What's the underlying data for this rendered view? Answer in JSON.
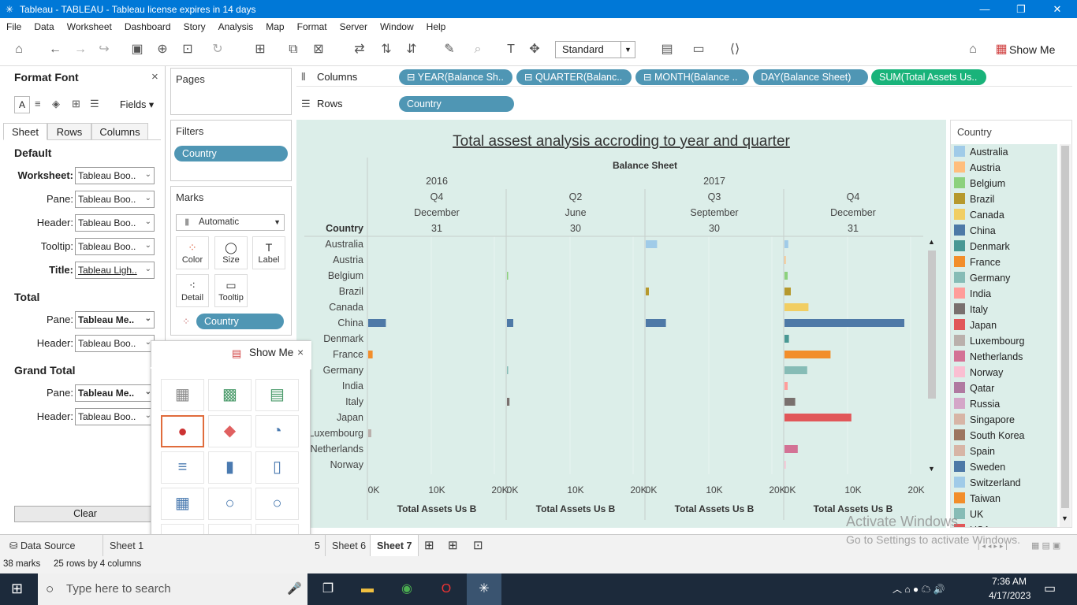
{
  "window": {
    "title": "Tableau - TABLEAU - Tableau license expires in 14 days"
  },
  "menu": [
    "File",
    "Data",
    "Worksheet",
    "Dashboard",
    "Story",
    "Analysis",
    "Map",
    "Format",
    "Server",
    "Window",
    "Help"
  ],
  "toolbar": {
    "fit_select": "Standard",
    "show_me_label": "Show Me"
  },
  "format_pane": {
    "title": "Format Font",
    "fields_label": "Fields",
    "tabs": [
      "Sheet",
      "Rows",
      "Columns"
    ],
    "default_title": "Default",
    "worksheet_label": "Worksheet:",
    "worksheet_value": "Tableau Boo..",
    "pane_label": "Pane:",
    "pane_value": "Tableau Boo..",
    "header_label": "Header:",
    "header_value": "Tableau Boo..",
    "tooltip_label": "Tooltip:",
    "tooltip_value": "Tableau Boo..",
    "title_label": "Title:",
    "title_value": "Tableau Ligh..",
    "total_title": "Total",
    "total_pane_label": "Pane:",
    "total_pane_value": "Tableau Me..",
    "total_header_label": "Header:",
    "total_header_value": "Tableau Boo..",
    "grand_total_title": "Grand Total",
    "grand_pane_label": "Pane:",
    "grand_pane_value": "Tableau Me..",
    "grand_header_label": "Header:",
    "grand_header_value": "Tableau Boo..",
    "clear_label": "Clear"
  },
  "pages_card": {
    "title": "Pages"
  },
  "filters_card": {
    "title": "Filters",
    "pill": "Country"
  },
  "marks_card": {
    "title": "Marks",
    "mark_type": "Automatic",
    "buttons": [
      "Color",
      "Size",
      "Label",
      "Detail",
      "Tooltip"
    ],
    "color_pill": "Country"
  },
  "shelves": {
    "columns_label": "Columns",
    "rows_label": "Rows",
    "column_pills": [
      "YEAR(Balance Sh..",
      "QUARTER(Balanc..",
      "MONTH(Balance ..",
      "DAY(Balance Sheet)",
      "SUM(Total Assets Us.."
    ],
    "row_pills": [
      "Country"
    ]
  },
  "show_me": {
    "title": "Show Me"
  },
  "bottom_tabs": {
    "data_source": "Data Source",
    "tabs": [
      "Sheet 1",
      "5",
      "Sheet 6",
      "Sheet 7"
    ]
  },
  "status": {
    "marks": "38 marks",
    "dims": "25 rows by 4 columns"
  },
  "taskbar": {
    "search_placeholder": "Type here to search",
    "time": "7:36 AM",
    "date": "4/17/2023"
  },
  "watermark": {
    "line1": "Activate Windows",
    "line2": "Go to Settings to activate Windows."
  },
  "legend": {
    "title": "Country",
    "items": [
      {
        "name": "Australia",
        "color": "#a0cbe8"
      },
      {
        "name": "Austria",
        "color": "#ffbe7d"
      },
      {
        "name": "Belgium",
        "color": "#8cd17d"
      },
      {
        "name": "Brazil",
        "color": "#b6992d"
      },
      {
        "name": "Canada",
        "color": "#f1ce63"
      },
      {
        "name": "China",
        "color": "#4e79a7"
      },
      {
        "name": "Denmark",
        "color": "#499894"
      },
      {
        "name": "France",
        "color": "#f28e2b"
      },
      {
        "name": "Germany",
        "color": "#86bcb6"
      },
      {
        "name": "India",
        "color": "#ff9d9a"
      },
      {
        "name": "Italy",
        "color": "#79706e"
      },
      {
        "name": "Japan",
        "color": "#e15759"
      },
      {
        "name": "Luxembourg",
        "color": "#bab0ac"
      },
      {
        "name": "Netherlands",
        "color": "#d37295"
      },
      {
        "name": "Norway",
        "color": "#fabfd2"
      },
      {
        "name": "Qatar",
        "color": "#b07aa1"
      },
      {
        "name": "Russia",
        "color": "#d4a6c8"
      },
      {
        "name": "Singapore",
        "color": "#d7b5a6"
      },
      {
        "name": "South Korea",
        "color": "#9d7660"
      },
      {
        "name": "Spain",
        "color": "#d7b5a6"
      },
      {
        "name": "Sweden",
        "color": "#4e79a7"
      },
      {
        "name": "Switzerland",
        "color": "#a0cbe8"
      },
      {
        "name": "Taiwan",
        "color": "#f28e2b"
      },
      {
        "name": "UK",
        "color": "#86bcb6"
      },
      {
        "name": "USA",
        "color": "#e15759"
      }
    ]
  },
  "chart_data": {
    "type": "bar",
    "title": "Total assest analysis accroding to year and quarter",
    "header_field": "Balance Sheet",
    "row_header": "Country",
    "panes": [
      {
        "year": "2016",
        "quarter": "Q4",
        "month": "December",
        "day": "31"
      },
      {
        "year": "2017",
        "quarter": "Q2",
        "month": "June",
        "day": "30"
      },
      {
        "year": "2017",
        "quarter": "Q3",
        "month": "September",
        "day": "30"
      },
      {
        "year": "2017",
        "quarter": "Q4",
        "month": "December",
        "day": "31"
      }
    ],
    "year_groups": [
      {
        "label": "2016",
        "panes": [
          0
        ]
      },
      {
        "label": "2017",
        "panes": [
          1,
          2,
          3
        ]
      }
    ],
    "categories": [
      "Australia",
      "Austria",
      "Belgium",
      "Brazil",
      "Canada",
      "China",
      "Denmark",
      "France",
      "Germany",
      "India",
      "Italy",
      "Japan",
      "Luxembourg",
      "Netherlands",
      "Norway"
    ],
    "series": [
      {
        "values": [
          0,
          0,
          0,
          0,
          0,
          2800,
          0,
          700,
          0,
          0,
          0,
          0,
          500,
          0,
          0
        ]
      },
      {
        "values": [
          0,
          0,
          150,
          0,
          0,
          1000,
          0,
          0,
          100,
          0,
          400,
          0,
          0,
          0,
          0
        ]
      },
      {
        "values": [
          1800,
          0,
          0,
          500,
          0,
          3200,
          0,
          0,
          0,
          0,
          0,
          0,
          0,
          0,
          0
        ]
      },
      {
        "values": [
          600,
          100,
          500,
          1000,
          3800,
          19000,
          700,
          7300,
          3600,
          500,
          1700,
          10600,
          0,
          2100,
          200
        ]
      }
    ],
    "xlim": [
      0,
      20000
    ],
    "xticks": [
      "0K",
      "10K",
      "20K"
    ],
    "xlabel": "Total Assets Us B"
  }
}
